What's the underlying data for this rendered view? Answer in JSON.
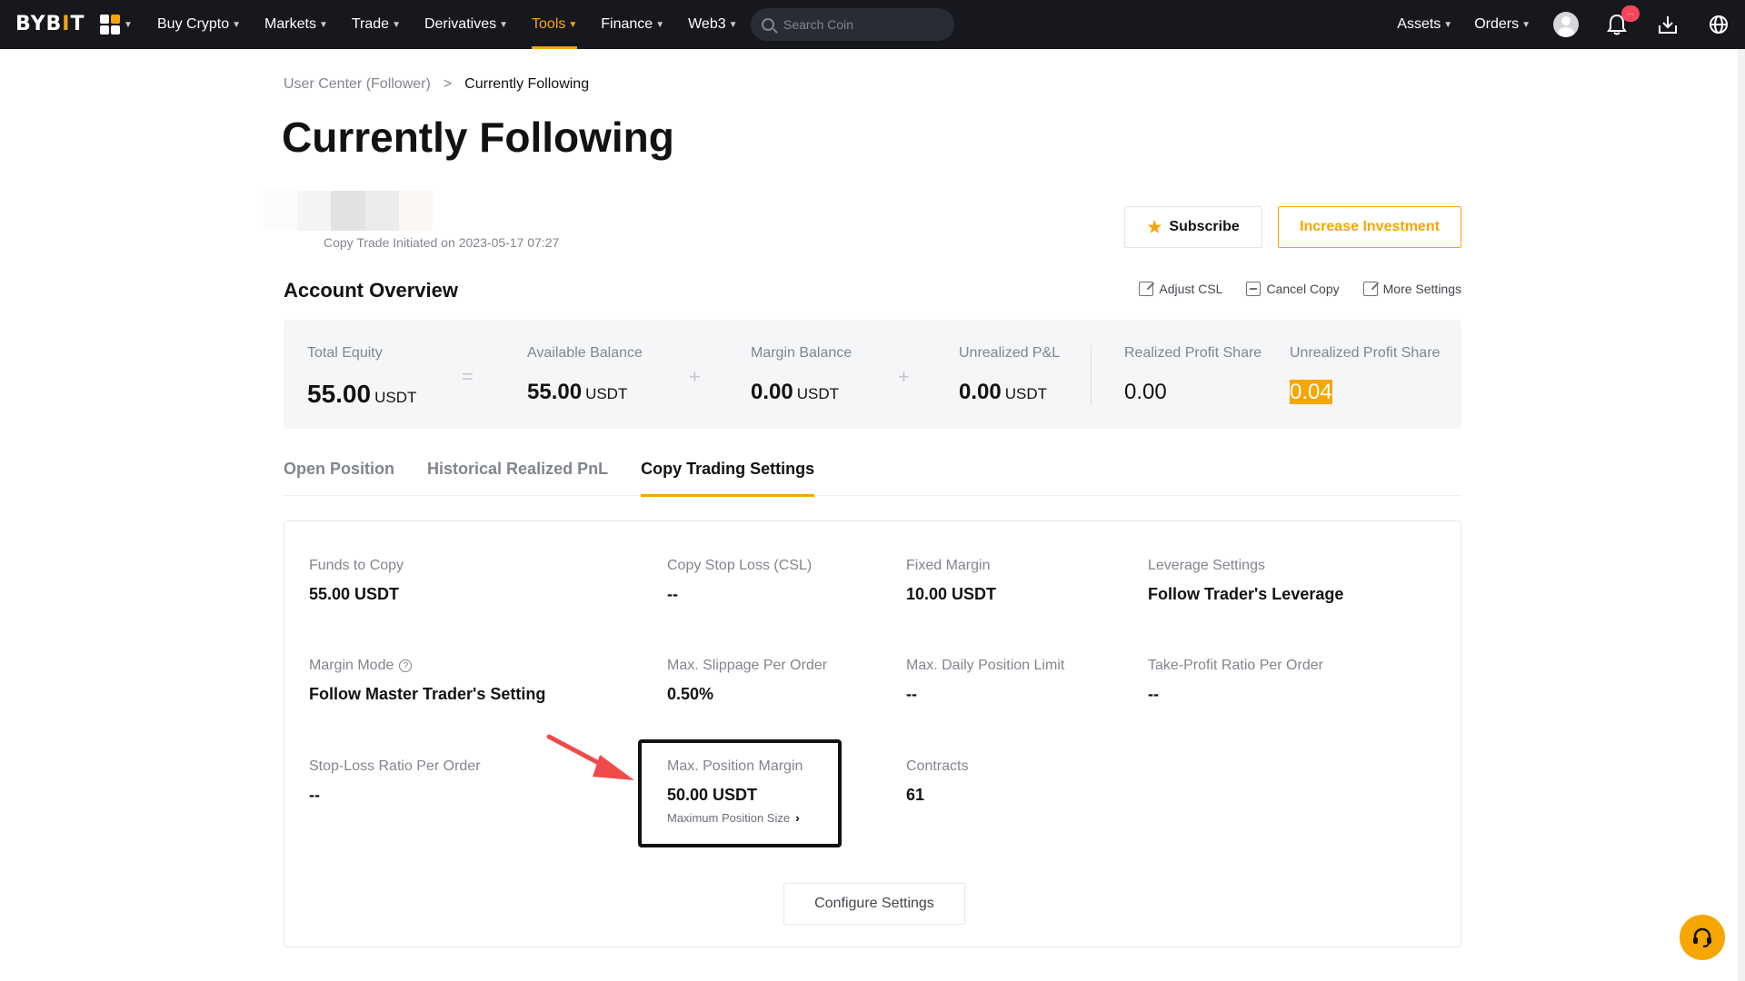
{
  "nav": {
    "logo_left": "BYB",
    "logo_mid": "I",
    "logo_right": "T",
    "menu": [
      "Buy Crypto",
      "Markets",
      "Trade",
      "Derivatives",
      "Tools",
      "Finance",
      "Web3"
    ],
    "active_menu": "Tools",
    "search_placeholder": "Search Coin",
    "assets": "Assets",
    "orders": "Orders",
    "notification_badge": "···"
  },
  "breadcrumb": {
    "parent": "User Center (Follower)",
    "separator": ">",
    "current": "Currently Following"
  },
  "page_title": "Currently Following",
  "trader": {
    "initiated_label": "Copy Trade Initiated on",
    "initiated_date": "2023-05-17 07:27"
  },
  "buttons": {
    "subscribe": "Subscribe",
    "increase": "Increase Investment",
    "configure": "Configure Settings"
  },
  "account_overview": {
    "title": "Account Overview",
    "actions": {
      "adjust_csl": "Adjust CSL",
      "cancel_copy": "Cancel Copy",
      "more_settings": "More Settings"
    },
    "total_equity": {
      "label": "Total Equity",
      "value": "55.00",
      "unit": "USDT"
    },
    "available_balance": {
      "label": "Available Balance",
      "value": "55.00",
      "unit": "USDT"
    },
    "margin_balance": {
      "label": "Margin Balance",
      "value": "0.00",
      "unit": "USDT"
    },
    "unrealized_pnl": {
      "label": "Unrealized P&L",
      "value": "0.00",
      "unit": "USDT"
    },
    "realized_profit_share": {
      "label": "Realized Profit Share",
      "value": "0.00"
    },
    "unrealized_profit_share": {
      "label": "Unrealized Profit Share",
      "value": "0.04"
    },
    "ops": {
      "equals": "=",
      "plus": "+"
    }
  },
  "tabs": [
    "Open Position",
    "Historical Realized PnL",
    "Copy Trading Settings"
  ],
  "settings": {
    "funds_to_copy": {
      "label": "Funds to Copy",
      "value": "55.00 USDT"
    },
    "copy_stop_loss": {
      "label": "Copy Stop Loss (CSL)",
      "value": "--"
    },
    "fixed_margin": {
      "label": "Fixed Margin",
      "value": "10.00 USDT"
    },
    "leverage_settings": {
      "label": "Leverage Settings",
      "value": "Follow Trader's Leverage"
    },
    "margin_mode": {
      "label": "Margin Mode",
      "value": "Follow Master Trader's Setting"
    },
    "max_slippage": {
      "label": "Max. Slippage Per Order",
      "value": "0.50%"
    },
    "max_daily_position": {
      "label": "Max. Daily Position Limit",
      "value": "--"
    },
    "take_profit_ratio": {
      "label": "Take-Profit Ratio Per Order",
      "value": "--"
    },
    "stop_loss_ratio": {
      "label": "Stop-Loss Ratio Per Order",
      "value": "--"
    },
    "max_position_margin": {
      "label": "Max. Position Margin",
      "value": "50.00 USDT",
      "link": "Maximum Position Size"
    },
    "contracts": {
      "label": "Contracts",
      "value": "61"
    }
  },
  "colors": {
    "accent": "#f7a600",
    "nav_bg": "#17181e",
    "arrow": "#f04b4b"
  }
}
